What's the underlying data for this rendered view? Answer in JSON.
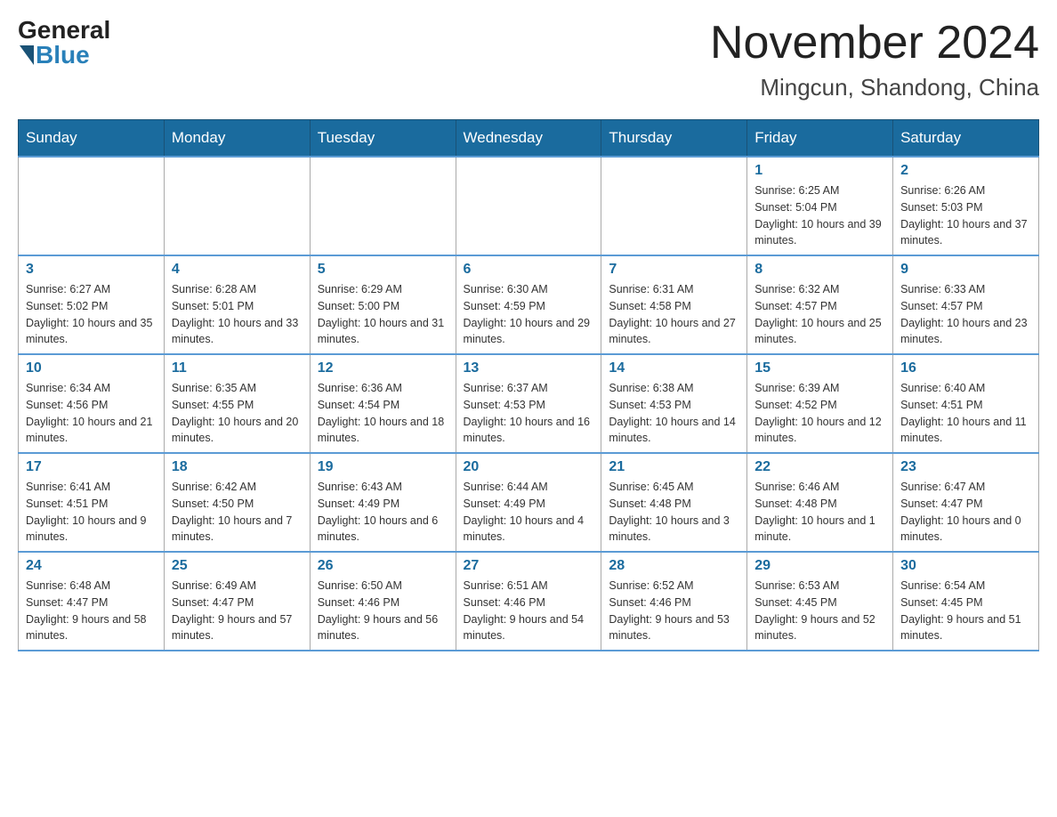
{
  "header": {
    "logo_general": "General",
    "logo_blue": "Blue",
    "month_title": "November 2024",
    "location": "Mingcun, Shandong, China"
  },
  "weekdays": [
    "Sunday",
    "Monday",
    "Tuesday",
    "Wednesday",
    "Thursday",
    "Friday",
    "Saturday"
  ],
  "weeks": [
    [
      {
        "day": "",
        "info": ""
      },
      {
        "day": "",
        "info": ""
      },
      {
        "day": "",
        "info": ""
      },
      {
        "day": "",
        "info": ""
      },
      {
        "day": "",
        "info": ""
      },
      {
        "day": "1",
        "info": "Sunrise: 6:25 AM\nSunset: 5:04 PM\nDaylight: 10 hours and 39 minutes."
      },
      {
        "day": "2",
        "info": "Sunrise: 6:26 AM\nSunset: 5:03 PM\nDaylight: 10 hours and 37 minutes."
      }
    ],
    [
      {
        "day": "3",
        "info": "Sunrise: 6:27 AM\nSunset: 5:02 PM\nDaylight: 10 hours and 35 minutes."
      },
      {
        "day": "4",
        "info": "Sunrise: 6:28 AM\nSunset: 5:01 PM\nDaylight: 10 hours and 33 minutes."
      },
      {
        "day": "5",
        "info": "Sunrise: 6:29 AM\nSunset: 5:00 PM\nDaylight: 10 hours and 31 minutes."
      },
      {
        "day": "6",
        "info": "Sunrise: 6:30 AM\nSunset: 4:59 PM\nDaylight: 10 hours and 29 minutes."
      },
      {
        "day": "7",
        "info": "Sunrise: 6:31 AM\nSunset: 4:58 PM\nDaylight: 10 hours and 27 minutes."
      },
      {
        "day": "8",
        "info": "Sunrise: 6:32 AM\nSunset: 4:57 PM\nDaylight: 10 hours and 25 minutes."
      },
      {
        "day": "9",
        "info": "Sunrise: 6:33 AM\nSunset: 4:57 PM\nDaylight: 10 hours and 23 minutes."
      }
    ],
    [
      {
        "day": "10",
        "info": "Sunrise: 6:34 AM\nSunset: 4:56 PM\nDaylight: 10 hours and 21 minutes."
      },
      {
        "day": "11",
        "info": "Sunrise: 6:35 AM\nSunset: 4:55 PM\nDaylight: 10 hours and 20 minutes."
      },
      {
        "day": "12",
        "info": "Sunrise: 6:36 AM\nSunset: 4:54 PM\nDaylight: 10 hours and 18 minutes."
      },
      {
        "day": "13",
        "info": "Sunrise: 6:37 AM\nSunset: 4:53 PM\nDaylight: 10 hours and 16 minutes."
      },
      {
        "day": "14",
        "info": "Sunrise: 6:38 AM\nSunset: 4:53 PM\nDaylight: 10 hours and 14 minutes."
      },
      {
        "day": "15",
        "info": "Sunrise: 6:39 AM\nSunset: 4:52 PM\nDaylight: 10 hours and 12 minutes."
      },
      {
        "day": "16",
        "info": "Sunrise: 6:40 AM\nSunset: 4:51 PM\nDaylight: 10 hours and 11 minutes."
      }
    ],
    [
      {
        "day": "17",
        "info": "Sunrise: 6:41 AM\nSunset: 4:51 PM\nDaylight: 10 hours and 9 minutes."
      },
      {
        "day": "18",
        "info": "Sunrise: 6:42 AM\nSunset: 4:50 PM\nDaylight: 10 hours and 7 minutes."
      },
      {
        "day": "19",
        "info": "Sunrise: 6:43 AM\nSunset: 4:49 PM\nDaylight: 10 hours and 6 minutes."
      },
      {
        "day": "20",
        "info": "Sunrise: 6:44 AM\nSunset: 4:49 PM\nDaylight: 10 hours and 4 minutes."
      },
      {
        "day": "21",
        "info": "Sunrise: 6:45 AM\nSunset: 4:48 PM\nDaylight: 10 hours and 3 minutes."
      },
      {
        "day": "22",
        "info": "Sunrise: 6:46 AM\nSunset: 4:48 PM\nDaylight: 10 hours and 1 minute."
      },
      {
        "day": "23",
        "info": "Sunrise: 6:47 AM\nSunset: 4:47 PM\nDaylight: 10 hours and 0 minutes."
      }
    ],
    [
      {
        "day": "24",
        "info": "Sunrise: 6:48 AM\nSunset: 4:47 PM\nDaylight: 9 hours and 58 minutes."
      },
      {
        "day": "25",
        "info": "Sunrise: 6:49 AM\nSunset: 4:47 PM\nDaylight: 9 hours and 57 minutes."
      },
      {
        "day": "26",
        "info": "Sunrise: 6:50 AM\nSunset: 4:46 PM\nDaylight: 9 hours and 56 minutes."
      },
      {
        "day": "27",
        "info": "Sunrise: 6:51 AM\nSunset: 4:46 PM\nDaylight: 9 hours and 54 minutes."
      },
      {
        "day": "28",
        "info": "Sunrise: 6:52 AM\nSunset: 4:46 PM\nDaylight: 9 hours and 53 minutes."
      },
      {
        "day": "29",
        "info": "Sunrise: 6:53 AM\nSunset: 4:45 PM\nDaylight: 9 hours and 52 minutes."
      },
      {
        "day": "30",
        "info": "Sunrise: 6:54 AM\nSunset: 4:45 PM\nDaylight: 9 hours and 51 minutes."
      }
    ]
  ]
}
